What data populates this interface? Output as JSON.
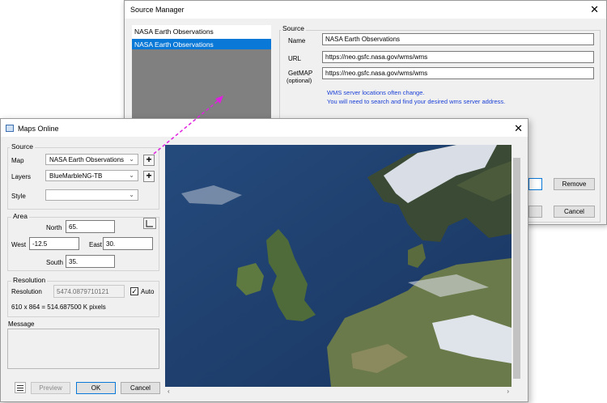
{
  "source_manager": {
    "title": "Source Manager",
    "list": [
      "NASA Earth Observations",
      "NASA Earth Observations"
    ],
    "source_legend": "Source",
    "name_label": "Name",
    "name_value": "NASA Earth Observations",
    "url_label": "URL",
    "url_value": "https://neo.gsfc.nasa.gov/wms/wms",
    "getmap_label": "GetMAP",
    "getmap_sub": "(optional)",
    "getmap_value": "https://neo.gsfc.nasa.gov/wms/wms",
    "note_line1": "WMS server locations often change.",
    "note_line2": "You will need to search and find your desired wms server address.",
    "remove_label": "Remove",
    "cancel_label": "Cancel"
  },
  "maps_online": {
    "title": "Maps Online",
    "source_legend": "Source",
    "map_label": "Map",
    "map_value": "NASA Earth Observations",
    "layers_label": "Layers",
    "layers_value": "BlueMarbleNG-TB",
    "style_label": "Style",
    "style_value": "",
    "area_legend": "Area",
    "north_label": "North",
    "north_value": "65.",
    "west_label": "West",
    "west_value": "-12.5",
    "east_label": "East",
    "east_value": "30.",
    "south_label": "South",
    "south_value": "35.",
    "resolution_legend": "Resolution",
    "resolution_label": "Resolution",
    "resolution_value": "5474.0879710121",
    "auto_label": "Auto",
    "auto_checked": true,
    "pixels_text": "610 x 864 = 514.687500 K pixels",
    "message_legend": "Message",
    "preview_label": "Preview",
    "ok_label": "OK",
    "cancel_label": "Cancel"
  },
  "colors": {
    "selection": "#0a78d7",
    "note_text": "#1a3fd6",
    "connector_arrow": "#e020e0",
    "ocean": "#1f3f6d"
  }
}
